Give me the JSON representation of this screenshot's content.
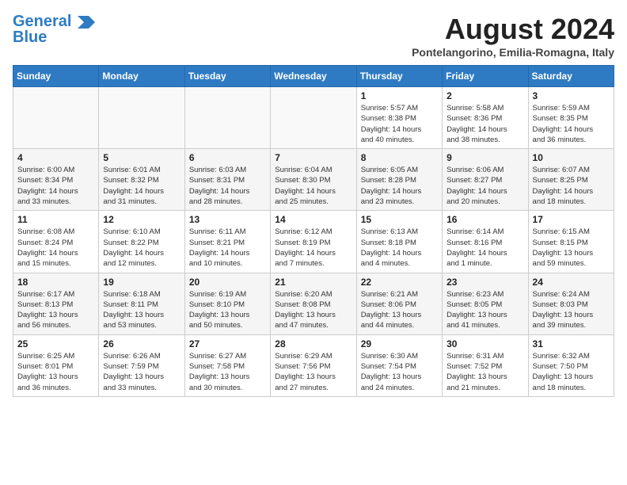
{
  "header": {
    "logo_line1": "General",
    "logo_line2": "Blue",
    "month_year": "August 2024",
    "location": "Pontelangorino, Emilia-Romagna, Italy"
  },
  "weekdays": [
    "Sunday",
    "Monday",
    "Tuesday",
    "Wednesday",
    "Thursday",
    "Friday",
    "Saturday"
  ],
  "weeks": [
    [
      {
        "day": "",
        "info": ""
      },
      {
        "day": "",
        "info": ""
      },
      {
        "day": "",
        "info": ""
      },
      {
        "day": "",
        "info": ""
      },
      {
        "day": "1",
        "info": "Sunrise: 5:57 AM\nSunset: 8:38 PM\nDaylight: 14 hours\nand 40 minutes."
      },
      {
        "day": "2",
        "info": "Sunrise: 5:58 AM\nSunset: 8:36 PM\nDaylight: 14 hours\nand 38 minutes."
      },
      {
        "day": "3",
        "info": "Sunrise: 5:59 AM\nSunset: 8:35 PM\nDaylight: 14 hours\nand 36 minutes."
      }
    ],
    [
      {
        "day": "4",
        "info": "Sunrise: 6:00 AM\nSunset: 8:34 PM\nDaylight: 14 hours\nand 33 minutes."
      },
      {
        "day": "5",
        "info": "Sunrise: 6:01 AM\nSunset: 8:32 PM\nDaylight: 14 hours\nand 31 minutes."
      },
      {
        "day": "6",
        "info": "Sunrise: 6:03 AM\nSunset: 8:31 PM\nDaylight: 14 hours\nand 28 minutes."
      },
      {
        "day": "7",
        "info": "Sunrise: 6:04 AM\nSunset: 8:30 PM\nDaylight: 14 hours\nand 25 minutes."
      },
      {
        "day": "8",
        "info": "Sunrise: 6:05 AM\nSunset: 8:28 PM\nDaylight: 14 hours\nand 23 minutes."
      },
      {
        "day": "9",
        "info": "Sunrise: 6:06 AM\nSunset: 8:27 PM\nDaylight: 14 hours\nand 20 minutes."
      },
      {
        "day": "10",
        "info": "Sunrise: 6:07 AM\nSunset: 8:25 PM\nDaylight: 14 hours\nand 18 minutes."
      }
    ],
    [
      {
        "day": "11",
        "info": "Sunrise: 6:08 AM\nSunset: 8:24 PM\nDaylight: 14 hours\nand 15 minutes."
      },
      {
        "day": "12",
        "info": "Sunrise: 6:10 AM\nSunset: 8:22 PM\nDaylight: 14 hours\nand 12 minutes."
      },
      {
        "day": "13",
        "info": "Sunrise: 6:11 AM\nSunset: 8:21 PM\nDaylight: 14 hours\nand 10 minutes."
      },
      {
        "day": "14",
        "info": "Sunrise: 6:12 AM\nSunset: 8:19 PM\nDaylight: 14 hours\nand 7 minutes."
      },
      {
        "day": "15",
        "info": "Sunrise: 6:13 AM\nSunset: 8:18 PM\nDaylight: 14 hours\nand 4 minutes."
      },
      {
        "day": "16",
        "info": "Sunrise: 6:14 AM\nSunset: 8:16 PM\nDaylight: 14 hours\nand 1 minute."
      },
      {
        "day": "17",
        "info": "Sunrise: 6:15 AM\nSunset: 8:15 PM\nDaylight: 13 hours\nand 59 minutes."
      }
    ],
    [
      {
        "day": "18",
        "info": "Sunrise: 6:17 AM\nSunset: 8:13 PM\nDaylight: 13 hours\nand 56 minutes."
      },
      {
        "day": "19",
        "info": "Sunrise: 6:18 AM\nSunset: 8:11 PM\nDaylight: 13 hours\nand 53 minutes."
      },
      {
        "day": "20",
        "info": "Sunrise: 6:19 AM\nSunset: 8:10 PM\nDaylight: 13 hours\nand 50 minutes."
      },
      {
        "day": "21",
        "info": "Sunrise: 6:20 AM\nSunset: 8:08 PM\nDaylight: 13 hours\nand 47 minutes."
      },
      {
        "day": "22",
        "info": "Sunrise: 6:21 AM\nSunset: 8:06 PM\nDaylight: 13 hours\nand 44 minutes."
      },
      {
        "day": "23",
        "info": "Sunrise: 6:23 AM\nSunset: 8:05 PM\nDaylight: 13 hours\nand 41 minutes."
      },
      {
        "day": "24",
        "info": "Sunrise: 6:24 AM\nSunset: 8:03 PM\nDaylight: 13 hours\nand 39 minutes."
      }
    ],
    [
      {
        "day": "25",
        "info": "Sunrise: 6:25 AM\nSunset: 8:01 PM\nDaylight: 13 hours\nand 36 minutes."
      },
      {
        "day": "26",
        "info": "Sunrise: 6:26 AM\nSunset: 7:59 PM\nDaylight: 13 hours\nand 33 minutes."
      },
      {
        "day": "27",
        "info": "Sunrise: 6:27 AM\nSunset: 7:58 PM\nDaylight: 13 hours\nand 30 minutes."
      },
      {
        "day": "28",
        "info": "Sunrise: 6:29 AM\nSunset: 7:56 PM\nDaylight: 13 hours\nand 27 minutes."
      },
      {
        "day": "29",
        "info": "Sunrise: 6:30 AM\nSunset: 7:54 PM\nDaylight: 13 hours\nand 24 minutes."
      },
      {
        "day": "30",
        "info": "Sunrise: 6:31 AM\nSunset: 7:52 PM\nDaylight: 13 hours\nand 21 minutes."
      },
      {
        "day": "31",
        "info": "Sunrise: 6:32 AM\nSunset: 7:50 PM\nDaylight: 13 hours\nand 18 minutes."
      }
    ]
  ]
}
